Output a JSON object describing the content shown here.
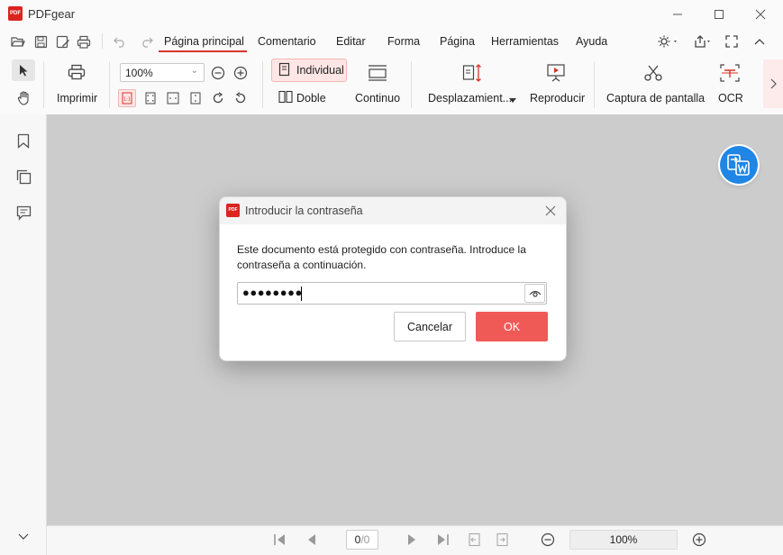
{
  "app": {
    "title": "PDFgear",
    "logo_text": "PDF"
  },
  "menu": {
    "items": [
      "Página principal",
      "Comentario",
      "Editar",
      "Forma",
      "Página",
      "Herramientas",
      "Ayuda"
    ],
    "active": "Página principal"
  },
  "ribbon": {
    "print_label": "Imprimir",
    "zoom_value": "100%",
    "individual_label": "Individual",
    "double_label": "Doble",
    "continuous_label": "Continuo",
    "scroll_label": "Desplazamient...",
    "play_label": "Reproducir",
    "screenshot_label": "Captura de pantalla",
    "ocr_label": "OCR"
  },
  "dialog": {
    "title": "Introducir la contraseña",
    "message": "Este documento está protegido con contraseña. Introduce la contraseña a continuación.",
    "password_masked": "●●●●●●●●",
    "cancel_label": "Cancelar",
    "ok_label": "OK"
  },
  "statusbar": {
    "page_current": "0",
    "page_total": "/0",
    "zoom": "100%"
  },
  "colors": {
    "accent": "#d9342b",
    "ok_button": "#ef5a57",
    "word_badge": "#1f86e5",
    "canvas": "#cccccc"
  }
}
